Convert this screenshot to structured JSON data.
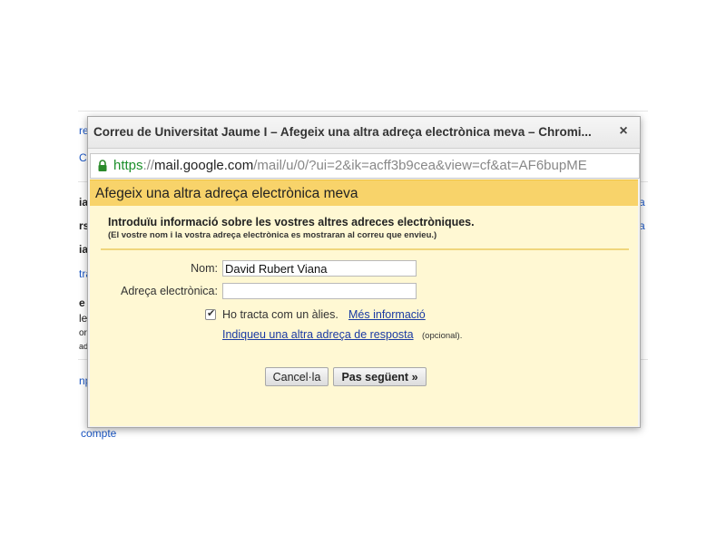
{
  "background": {
    "fragments": [
      {
        "text": "re",
        "cls": "bg-link"
      },
      {
        "text": "Cr",
        "cls": "bg-link"
      },
      {
        "text": "ia",
        "cls": "bg-bold"
      },
      {
        "text": "rs",
        "cls": "bg-bold"
      },
      {
        "text": "ia",
        "cls": "bg-bold"
      },
      {
        "text": "tra",
        "cls": "bg-link"
      },
      {
        "text": "e",
        "cls": "bg-bold"
      },
      {
        "text": "le",
        "cls": "bg-text"
      },
      {
        "text": "ore",
        "cls": "bg-text"
      },
      {
        "text": "adr",
        "cls": "bg-text"
      },
      {
        "text": "np",
        "cls": "bg-link"
      },
      {
        "text": "compte",
        "cls": "bg-link"
      },
      {
        "text": "a",
        "cls": "bg-link"
      },
      {
        "text": "a",
        "cls": "bg-link"
      }
    ]
  },
  "window": {
    "title": "Correu de Universitat Jaume I – Afegeix una altra adreça electrònica meva – Chromi...",
    "close_label": "×"
  },
  "urlbar": {
    "scheme": "https",
    "separator": "://",
    "host": "mail.google.com",
    "path": "/mail/u/0/?ui=2&ik=acff3b9cea&view=cf&at=AF6bupME"
  },
  "dialog": {
    "title": "Afegeix una altra adreça electrònica meva",
    "intro": "Introduïu informació sobre les vostres altres adreces electròniques.",
    "intro_sub": "(El vostre nom i la vostra adreça electrònica es mostraran al correu que envieu.)",
    "name_label": "Nom:",
    "name_value": "David Rubert Viana",
    "email_label": "Adreça electrònica:",
    "email_value": "",
    "alias_checked": true,
    "alias_text": "Ho tracta com un àlies.",
    "more_info_link": "Més informació",
    "reply_to_link": "Indiqueu una altra adreça de resposta",
    "optional_text": "(opcional).",
    "cancel_button": "Cancel·la",
    "next_button": "Pas següent »"
  },
  "colors": {
    "dialog_header": "#f8d36a",
    "dialog_body": "#fff8d3",
    "link": "#1a3aa3",
    "https_green": "#1b8f2a"
  }
}
